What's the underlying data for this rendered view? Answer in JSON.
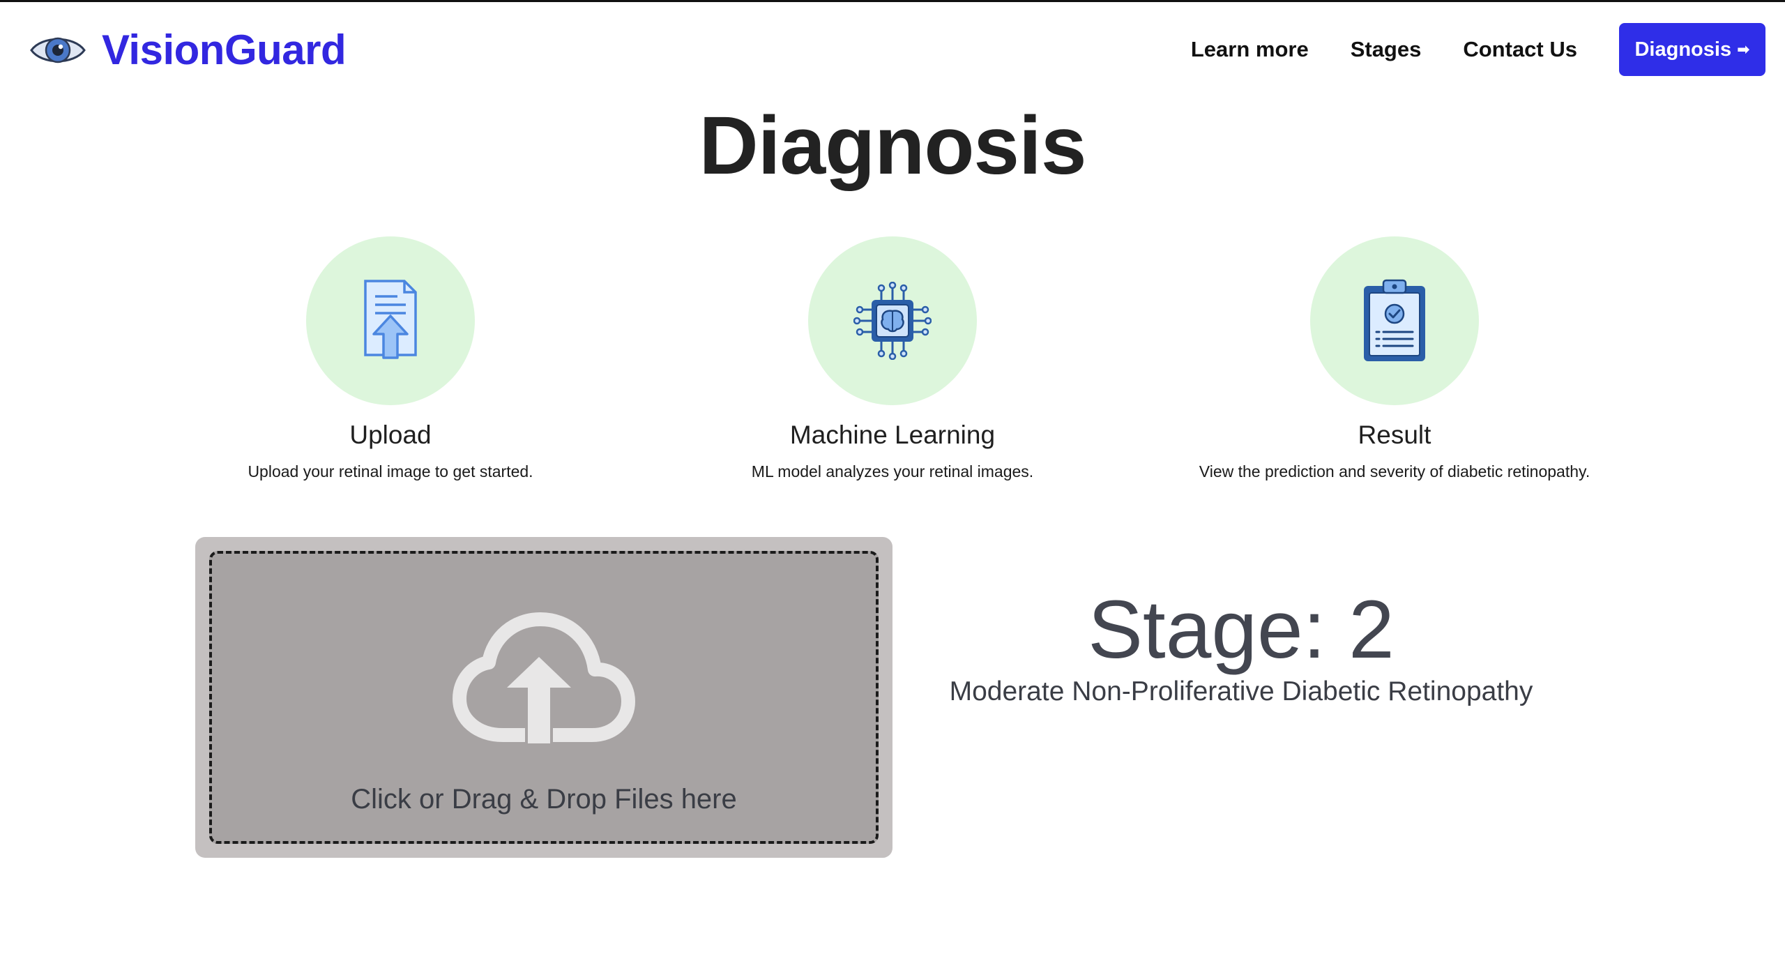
{
  "header": {
    "brand": "VisionGuard",
    "nav": [
      "Learn more",
      "Stages",
      "Contact Us"
    ],
    "cta_label": "Diagnosis",
    "cta_arrow": "➡"
  },
  "main": {
    "title": "Diagnosis",
    "steps": [
      {
        "title": "Upload",
        "description": "Upload your retinal image to get started.",
        "icon": "document-upload-icon"
      },
      {
        "title": "Machine Learning",
        "description": "ML model analyzes your retinal images.",
        "icon": "brain-chip-icon"
      },
      {
        "title": "Result",
        "description": "View the prediction and severity of diabetic retinopathy.",
        "icon": "clipboard-result-icon"
      }
    ],
    "upload": {
      "label": "Click or Drag & Drop Files here",
      "icon": "cloud-upload-icon"
    },
    "result": {
      "stage": "Stage: 2",
      "description": "Moderate Non-Proliferative Diabetic Retinopathy"
    }
  },
  "colors": {
    "brand": "#3227e0",
    "cta": "#2f2ee8",
    "step_circle": "#ddf6dc",
    "upload_outer": "#c4c0c0",
    "upload_inner": "#a7a3a3",
    "stage_text": "#434650"
  }
}
